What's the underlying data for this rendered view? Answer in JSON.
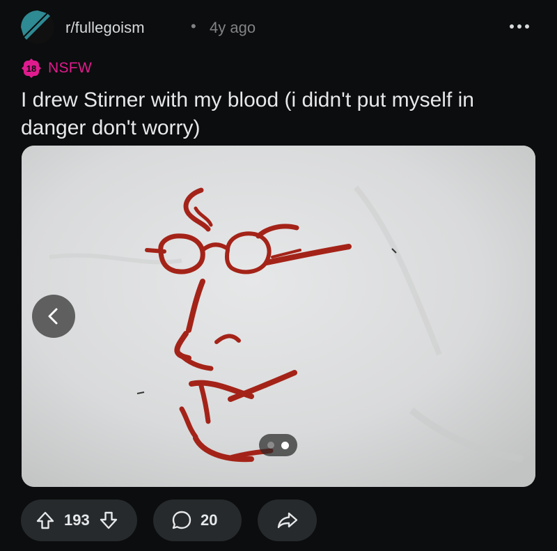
{
  "post": {
    "subreddit": "r/fullegoism",
    "separator": "•",
    "age": "4y ago",
    "more_icon": "more-horizontal-icon",
    "nsfw": {
      "badge_text": "18",
      "label": "NSFW",
      "color": "#e01b8e"
    },
    "title": "I drew Stirner with my blood (i didn't put myself in danger don't worry)",
    "media": {
      "pager": {
        "total": 2,
        "active_index": 1
      },
      "prev_icon": "chevron-left-icon"
    },
    "actions": {
      "upvote_icon": "arrow-up-icon",
      "downvote_icon": "arrow-down-icon",
      "score": "193",
      "comment_icon": "comment-bubble-icon",
      "comments": "20",
      "share_icon": "share-arrow-icon"
    }
  },
  "colors": {
    "background": "#0b0d0e",
    "button_bg": "#272a2c",
    "text": "#e6e8ea",
    "muted": "#818384",
    "avatar_teal": "#2e8a93"
  }
}
